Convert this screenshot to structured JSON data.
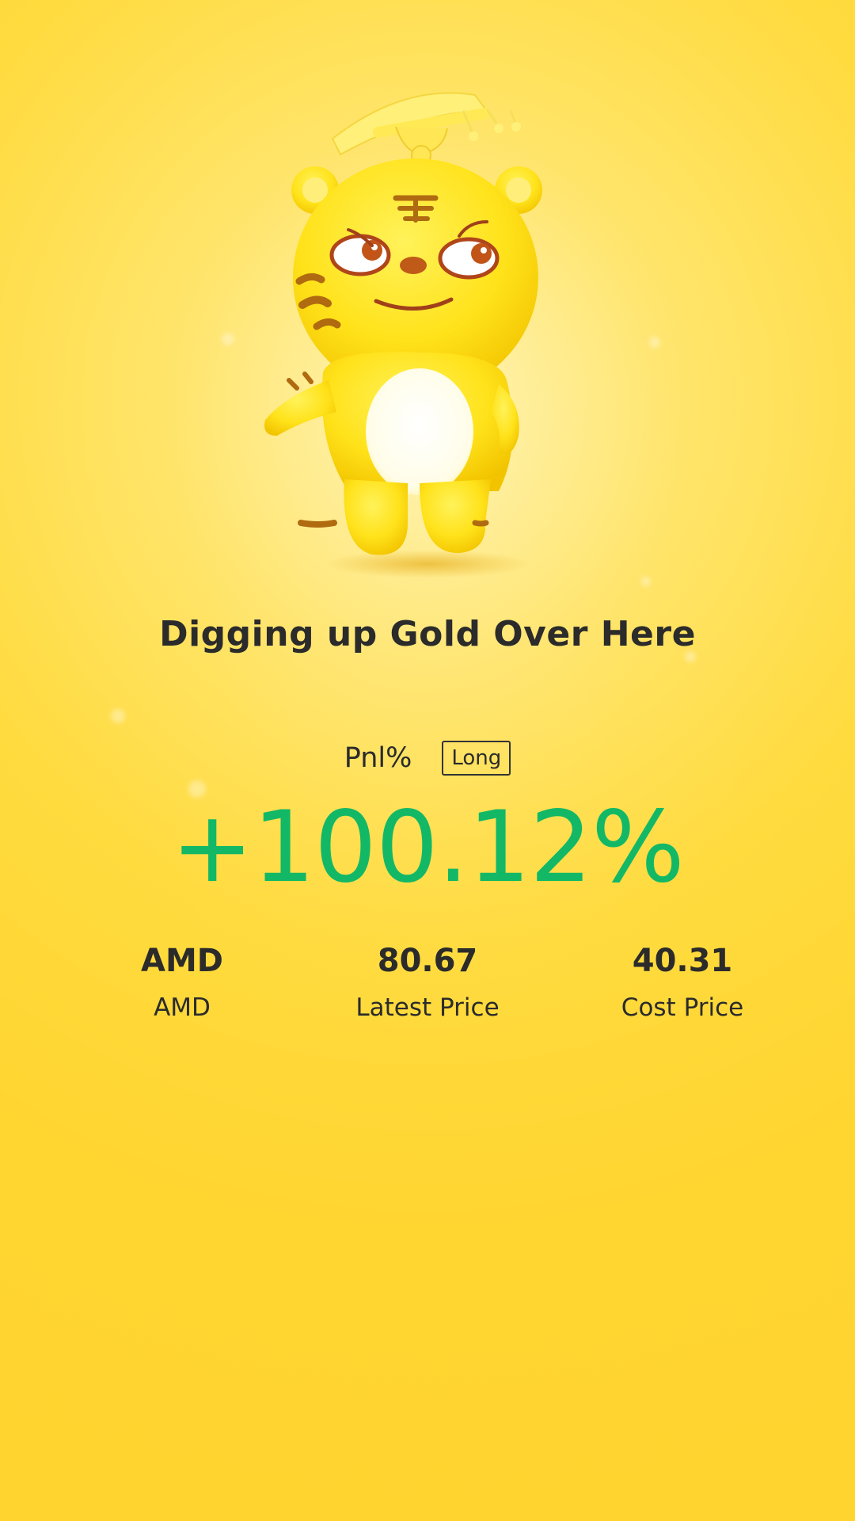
{
  "headline": "Digging up Gold Over Here",
  "pnl": {
    "label": "Pnl%",
    "position_badge": "Long",
    "value": "+100.12%",
    "color": "#12b866"
  },
  "stats": [
    {
      "value": "AMD",
      "label": "AMD"
    },
    {
      "value": "80.67",
      "label": "Latest Price"
    },
    {
      "value": "40.31",
      "label": "Cost Price"
    }
  ],
  "background_color": "#ffd530",
  "mascot_icon": "tiger-mascot-icon"
}
